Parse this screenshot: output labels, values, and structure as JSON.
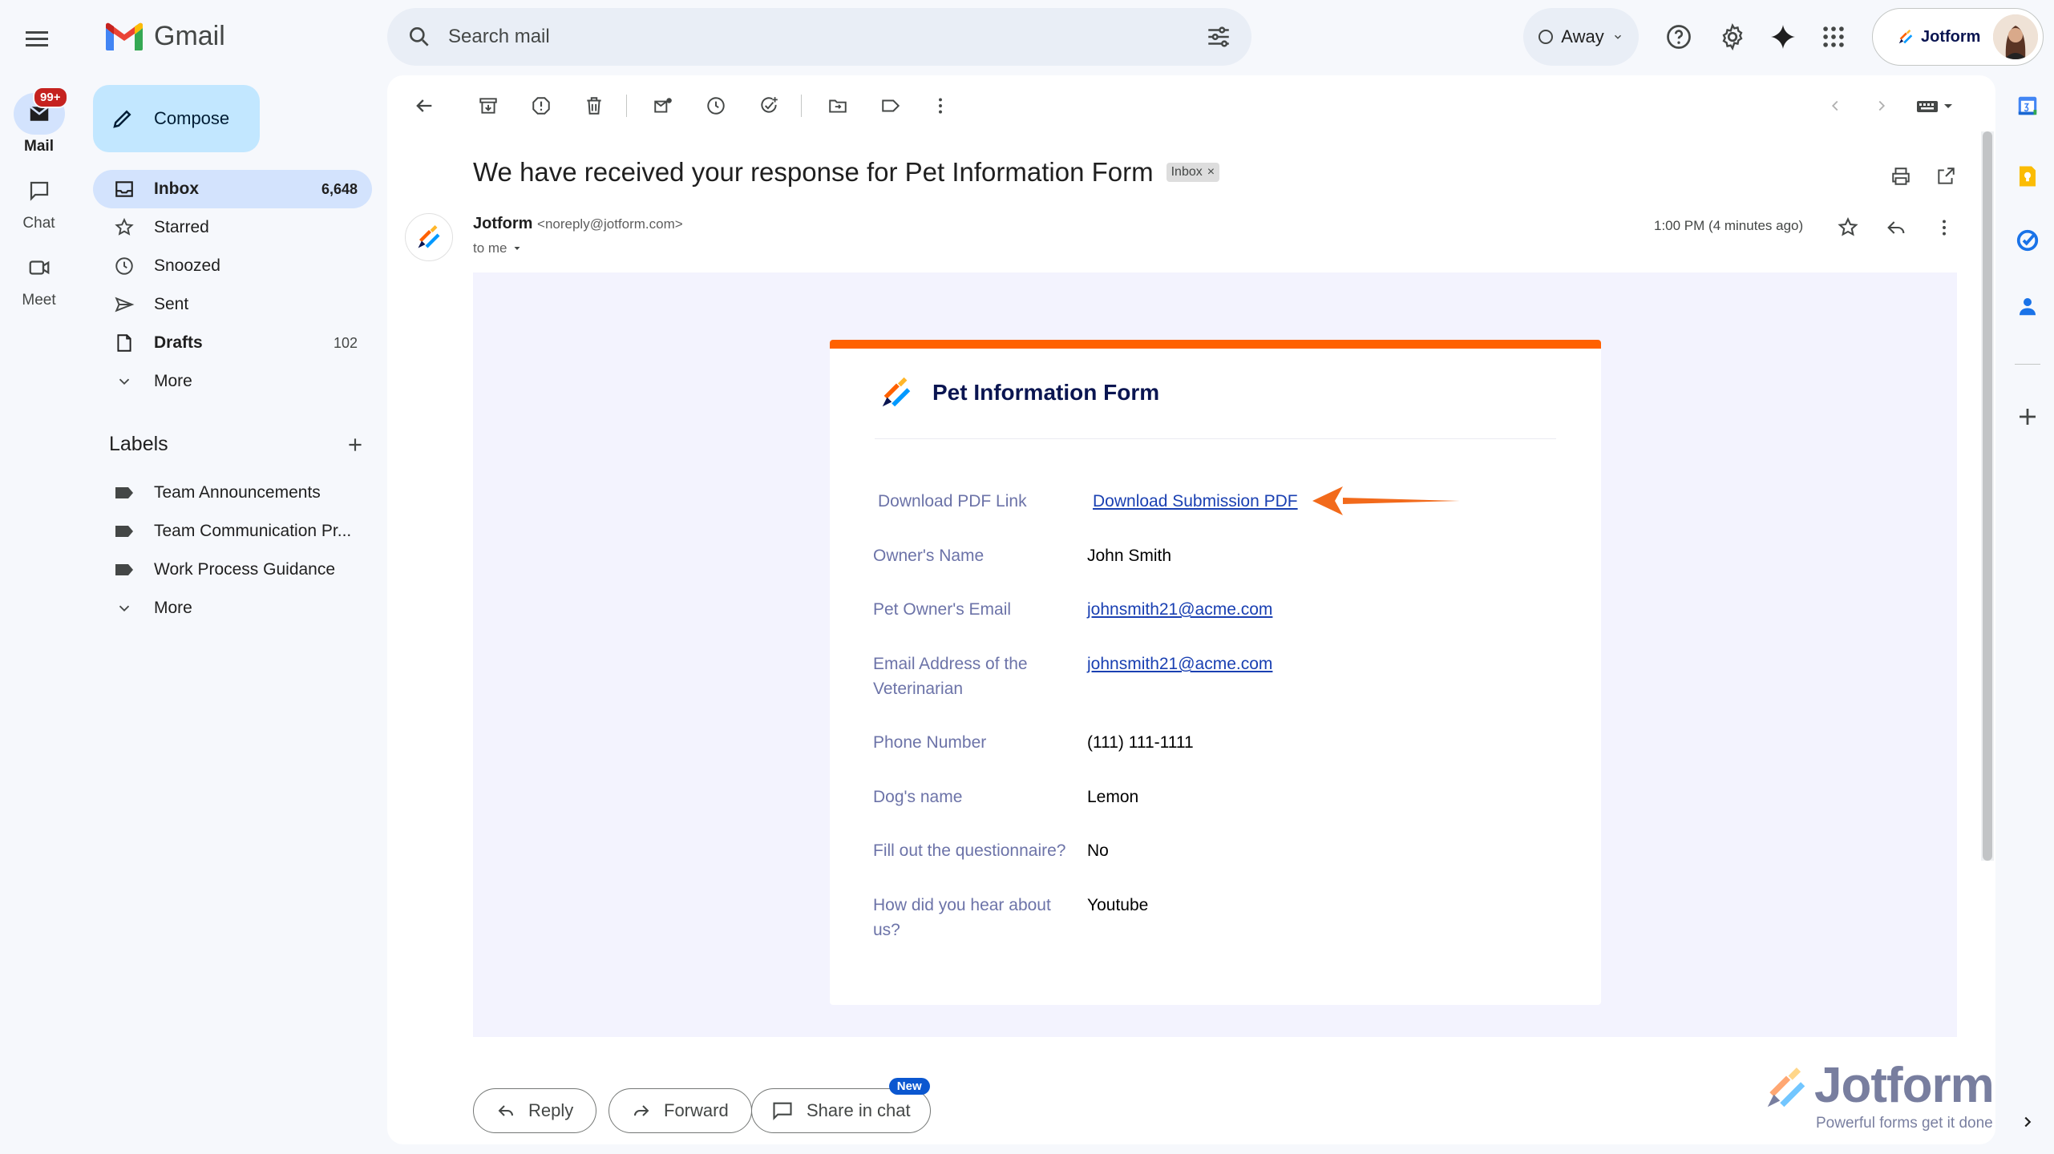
{
  "app": {
    "name": "Gmail"
  },
  "rail": {
    "mail_label": "Mail",
    "mail_badge": "99+",
    "chat_label": "Chat",
    "meet_label": "Meet"
  },
  "search": {
    "placeholder": "Search mail"
  },
  "status": {
    "label": "Away"
  },
  "account": {
    "name": "Jotform"
  },
  "compose": {
    "label": "Compose"
  },
  "nav": {
    "items": [
      {
        "label": "Inbox",
        "count": "6,648",
        "icon": "inbox-icon"
      },
      {
        "label": "Starred",
        "count": "",
        "icon": "star-icon"
      },
      {
        "label": "Snoozed",
        "count": "",
        "icon": "clock-icon"
      },
      {
        "label": "Sent",
        "count": "",
        "icon": "send-icon"
      },
      {
        "label": "Drafts",
        "count": "102",
        "icon": "draft-icon"
      },
      {
        "label": "More",
        "count": "",
        "icon": "chevron-down-icon"
      }
    ]
  },
  "labels": {
    "title": "Labels",
    "items": [
      {
        "label": "Team Announcements"
      },
      {
        "label": "Team Communication Pr..."
      },
      {
        "label": "Work Process Guidance"
      },
      {
        "label": "More"
      }
    ]
  },
  "message": {
    "subject": "We have received your response for Pet Information Form",
    "chip": "Inbox",
    "chip_close": "×",
    "sender_name": "Jotform",
    "sender_email": "<noreply@jotform.com>",
    "to": "to me",
    "time": "1:00 PM (4 minutes ago)"
  },
  "form": {
    "title": "Pet Information Form",
    "rows": [
      {
        "label": "Download PDF Link",
        "value": "Download Submission PDF",
        "link": true
      },
      {
        "label": "Owner's Name",
        "value": "John Smith",
        "link": false
      },
      {
        "label": "Pet Owner's Email",
        "value": "johnsmith21@acme.com",
        "link": true
      },
      {
        "label": "Email Address of the Veterinarian",
        "value": "johnsmith21@acme.com",
        "link": true
      },
      {
        "label": "Phone Number",
        "value": "(111) 111-1111",
        "link": false
      },
      {
        "label": "Dog's name",
        "value": "Lemon",
        "link": false
      },
      {
        "label": "Fill out the questionnaire?",
        "value": "No",
        "link": false
      },
      {
        "label": "How did you hear about us?",
        "value": "Youtube",
        "link": false
      }
    ]
  },
  "actions": {
    "reply": "Reply",
    "forward": "Forward",
    "share": "Share in chat",
    "new_badge": "New"
  },
  "watermark": {
    "brand": "Jotform",
    "tagline": "Powerful forms get it done"
  },
  "colors": {
    "accent_orange": "#ff6100",
    "link_blue": "#1a40b2",
    "brand_navy": "#0a1551"
  }
}
